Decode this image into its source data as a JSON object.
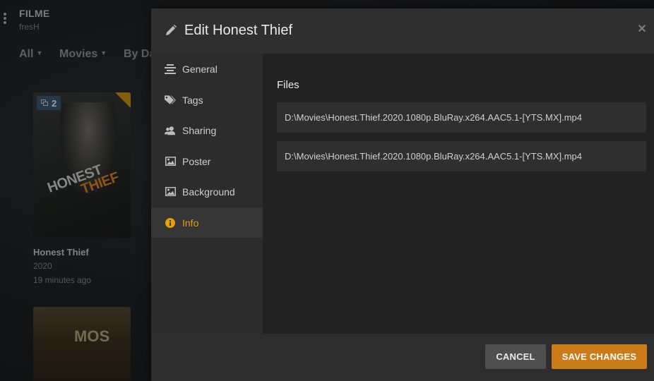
{
  "library": {
    "title": "FILME",
    "subtitle": "fresH",
    "filters": [
      {
        "label": "All",
        "has_caret": true
      },
      {
        "label": "Movies",
        "has_caret": true
      },
      {
        "label": "By Da",
        "has_caret": false
      }
    ]
  },
  "cards": [
    {
      "title": "Honest Thief",
      "year": "2020",
      "added": "19 minutes ago",
      "copies_badge": "2",
      "poster_text_line1": "HONEST",
      "poster_text_line2": "THIEF"
    },
    {
      "poster_text": "MOS"
    }
  ],
  "modal": {
    "title": "Edit Honest Thief",
    "close_symbol": "×",
    "nav": [
      {
        "label": "General",
        "icon": "general-icon"
      },
      {
        "label": "Tags",
        "icon": "tags-icon"
      },
      {
        "label": "Sharing",
        "icon": "sharing-icon"
      },
      {
        "label": "Poster",
        "icon": "poster-image-icon"
      },
      {
        "label": "Background",
        "icon": "background-image-icon"
      },
      {
        "label": "Info",
        "icon": "info-icon",
        "active": true
      }
    ],
    "files_heading": "Files",
    "files": [
      "D:\\Movies\\Honest.Thief.2020.1080p.BluRay.x264.AAC5.1-[YTS.MX].mp4",
      "D:\\Movies\\Honest.Thief.2020.1080p.BluRay.x264.AAC5.1-[YTS.MX].mp4"
    ],
    "cancel_label": "CANCEL",
    "save_label": "SAVE CHANGES"
  },
  "colors": {
    "accent": "#e5a00d",
    "save_button": "#cc7b19",
    "cancel_button": "#4f4f4f",
    "badge": "#3d5c7a"
  }
}
